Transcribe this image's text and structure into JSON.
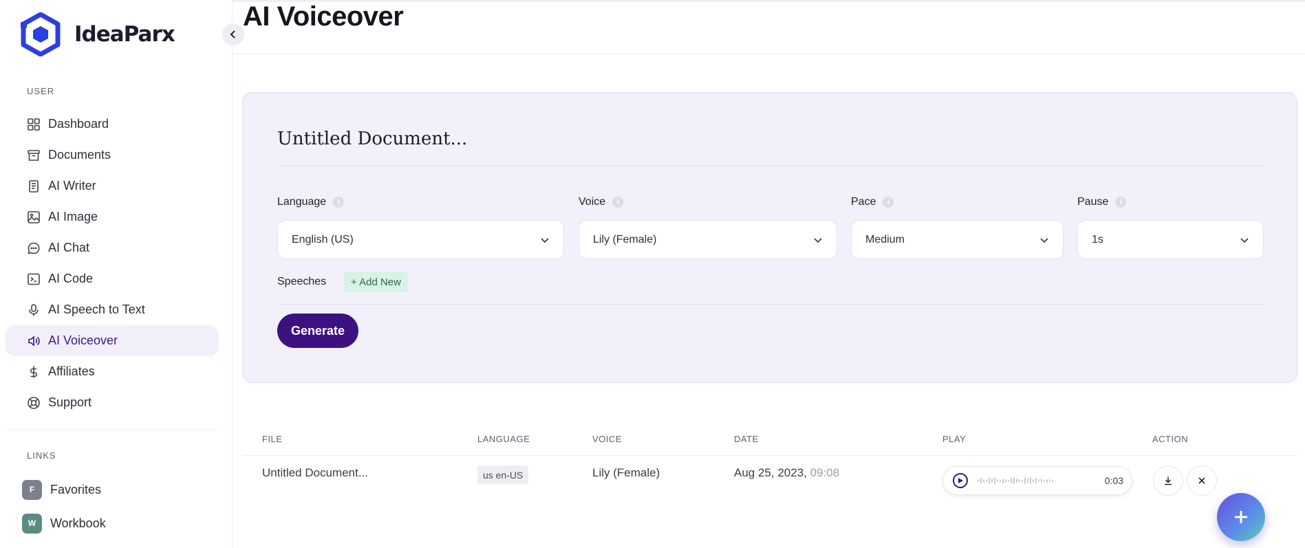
{
  "app": {
    "logo_text": "IdeaParx",
    "brand_color": "#2b3fe0"
  },
  "sidebar": {
    "user_section_label": "USER",
    "items": [
      {
        "label": "Dashboard",
        "icon": "grid-icon"
      },
      {
        "label": "Documents",
        "icon": "archive-icon"
      },
      {
        "label": "AI Writer",
        "icon": "file-text-icon"
      },
      {
        "label": "AI Image",
        "icon": "image-icon"
      },
      {
        "label": "AI Chat",
        "icon": "chat-icon"
      },
      {
        "label": "AI Code",
        "icon": "terminal-icon"
      },
      {
        "label": "AI Speech to Text",
        "icon": "microphone-icon"
      },
      {
        "label": "AI Voiceover",
        "icon": "speaker-icon",
        "active": true
      },
      {
        "label": "Affiliates",
        "icon": "dollar-icon"
      },
      {
        "label": "Support",
        "icon": "lifebuoy-icon"
      }
    ],
    "links_section_label": "LINKS",
    "links": [
      {
        "label": "Favorites",
        "initial": "F",
        "color": "#7b7f8e"
      },
      {
        "label": "Workbook",
        "initial": "W",
        "color": "#5c8b84"
      }
    ]
  },
  "page": {
    "title": "AI Voiceover"
  },
  "editor": {
    "document_title": "Untitled Document...",
    "language_label": "Language",
    "language_value": "English (US)",
    "voice_label": "Voice",
    "voice_value": "Lily (Female)",
    "pace_label": "Pace",
    "pace_value": "Medium",
    "pause_label": "Pause",
    "pause_value": "1s",
    "speeches_label": "Speeches",
    "add_new_label": "+ Add New",
    "generate_label": "Generate"
  },
  "table": {
    "headers": {
      "file": "FILE",
      "language": "LANGUAGE",
      "voice": "VOICE",
      "date": "DATE",
      "play": "PLAY",
      "action": "ACTION"
    },
    "rows": [
      {
        "file": "Untitled Document...",
        "language": "us en-US",
        "voice": "Lily (Female)",
        "date": "Aug 25, 2023,",
        "time": "09:08",
        "duration": "0:03"
      }
    ]
  }
}
